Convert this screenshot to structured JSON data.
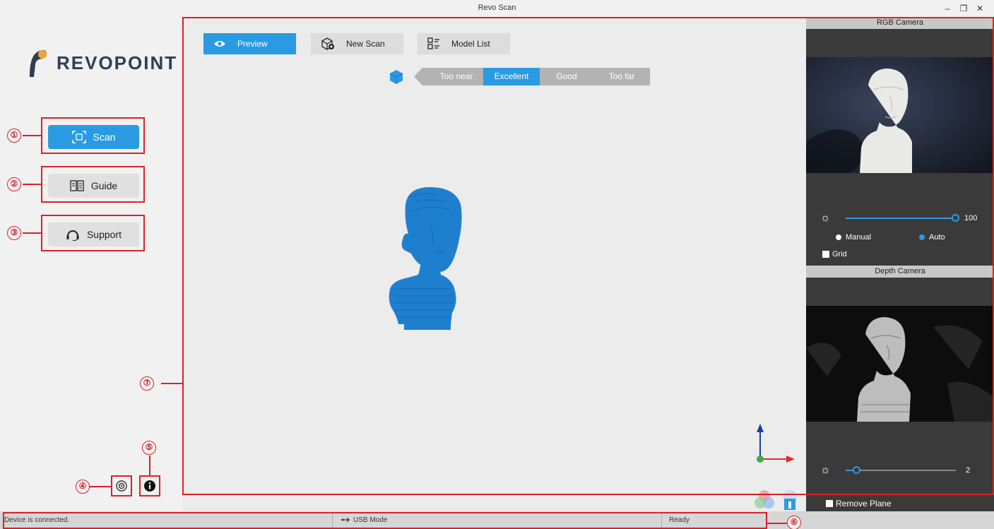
{
  "window": {
    "title": "Revo Scan",
    "minimize_glyph": "–",
    "maximize_glyph": "❐",
    "close_glyph": "✕"
  },
  "sidebar": {
    "logo_text": "REVOPOINT",
    "buttons": [
      {
        "label": "Scan",
        "icon": "scan-icon",
        "active": true
      },
      {
        "label": "Guide",
        "icon": "book-icon",
        "active": false
      },
      {
        "label": "Support",
        "icon": "headset-icon",
        "active": false
      }
    ],
    "bottom_icons": [
      "settings-icon",
      "info-icon"
    ]
  },
  "toolbar": {
    "preview_label": "Preview",
    "new_scan_label": "New Scan",
    "model_list_label": "Model List"
  },
  "distance": {
    "segments": [
      "Too near",
      "Excellent",
      "Good",
      "Too far"
    ],
    "active": "Excellent"
  },
  "rgb_camera": {
    "title": "RGB Camera",
    "brightness_value": "100",
    "brightness_level_pct": 100,
    "modes": [
      "Manual",
      "Auto"
    ],
    "selected_mode": "Auto",
    "grid_label": "Grid"
  },
  "depth_camera": {
    "title": "Depth Camera",
    "exposure_value": "2",
    "exposure_level_pct": 10,
    "remove_plane_label": "Remove Plane"
  },
  "statusbar": {
    "connection": "Device is connected.",
    "usb_mode": "USB Mode",
    "state": "Ready"
  },
  "callouts": [
    "①",
    "②",
    "③",
    "④",
    "⑤",
    "⑥",
    "⑦"
  ],
  "colors": {
    "accent": "#2a9be3",
    "annotation": "#d7232b",
    "model": "#1e7fcf"
  }
}
